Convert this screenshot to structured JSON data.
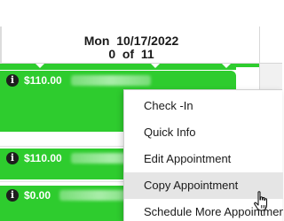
{
  "header": {
    "date": "Mon  10/17/2022",
    "count": "0  of  11"
  },
  "appointments": [
    {
      "price": "$110.00",
      "info_icon": "info-icon"
    },
    {
      "price": "$110.00",
      "info_icon": "info-icon"
    },
    {
      "price": "$0.00",
      "info_icon": "info-icon"
    }
  ],
  "context_menu": {
    "items": [
      {
        "label": "Check -In"
      },
      {
        "label": "Quick Info"
      },
      {
        "label": "Edit Appointment"
      },
      {
        "label": "Copy Appointment",
        "highlighted": true
      },
      {
        "label": "Schedule More Appointments"
      }
    ]
  },
  "colors": {
    "appointment_green": "#2ecc2e",
    "menu_highlight": "#e5e5e5"
  },
  "cursor": "hand-pointer-icon"
}
